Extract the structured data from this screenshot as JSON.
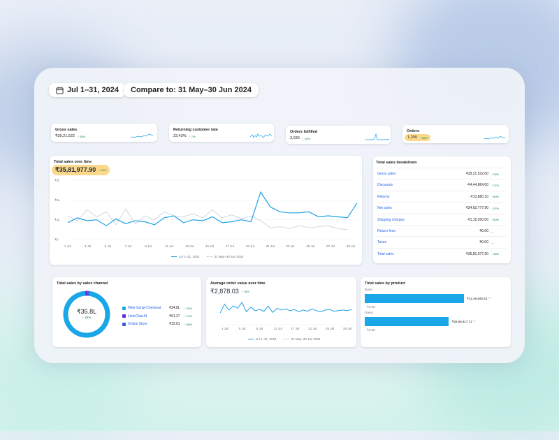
{
  "date_range": {
    "label": "Jul 1–31, 2024"
  },
  "compare": {
    "label": "Compare to: 31 May–30 Jun 2024"
  },
  "metrics": [
    {
      "title": "Gross sales",
      "value": "₹39,21,522",
      "change": "↑ 28%"
    },
    {
      "title": "Returning customer rate",
      "value": "23.43%",
      "change": "↑ 7%"
    },
    {
      "title": "Orders fulfilled",
      "value": "3,039",
      "change": "↑ 16%"
    },
    {
      "title": "Orders",
      "value": "1,209",
      "change": "↑ 65%"
    }
  ],
  "sales_over_time": {
    "title": "Total sales over time",
    "value": "₹35,81,977.90",
    "change": "↑ 36%",
    "legend_current": "Jul 1–31, 2024",
    "legend_previous": "31 May–30 Jun 2024"
  },
  "chart_data": [
    {
      "type": "line",
      "title": "Total sales over time",
      "y_ticks": [
        "₹3L",
        "₹2L",
        "₹1L",
        "₹0"
      ],
      "ylim": [
        0,
        300000
      ],
      "x_ticks": [
        "1 Jul",
        "3 Jul",
        "5 Jul",
        "7 Jul",
        "9 Jul",
        "11 Jul",
        "13 Jul",
        "15 Jul",
        "17 Jul",
        "19 Jul",
        "21 Jul",
        "23 Jul",
        "25 Jul",
        "27 Jul",
        "29 Jul"
      ],
      "series": [
        {
          "name": "Jul 1–31, 2024",
          "color": "#1da1e6",
          "values": [
            85000,
            110000,
            95000,
            100000,
            70000,
            105000,
            80000,
            95000,
            90000,
            75000,
            110000,
            120000,
            85000,
            100000,
            95000,
            115000,
            85000,
            90000,
            100000,
            90000,
            240000,
            165000,
            140000,
            135000,
            135000,
            140000,
            115000,
            120000,
            115000,
            110000,
            185000
          ]
        },
        {
          "name": "31 May–30 Jun 2024",
          "color": "#c7cdd6",
          "values": [
            120000,
            95000,
            150000,
            115000,
            140000,
            75000,
            155000,
            80000,
            120000,
            100000,
            140000,
            120000,
            115000,
            130000,
            110000,
            150000,
            110000,
            125000,
            105000,
            120000,
            95000,
            60000,
            65000,
            55000,
            70000,
            60000,
            65000,
            70000,
            55000,
            50000
          ]
        }
      ]
    },
    {
      "type": "pie",
      "title": "Total sales by sales channel",
      "center_value": "₹35.8L",
      "center_change": "↑ 36%",
      "slices": [
        {
          "label": "Web-Sangi-Checkout",
          "value": "₹34.8L",
          "change": "↑ 40%",
          "color": "#1aa7e8",
          "share": 0.97
        },
        {
          "label": "LimeChat AI",
          "value": "₹91.27",
          "change": "↑ 74%",
          "color": "#6d28d9",
          "share": 0.02
        },
        {
          "label": "Online Store",
          "value": "₹12.61",
          "change": "↑ 68%",
          "color": "#3b5bdb",
          "share": 0.01
        }
      ]
    },
    {
      "type": "line",
      "title": "Average order value over time",
      "value": "₹2,878.03",
      "change": "↑ 15%",
      "x_ticks": [
        "1 Jul",
        "5 Jul",
        "9 Jul",
        "13 Jul",
        "17 Jul",
        "21 Jul",
        "25 Jul",
        "29 Jul"
      ],
      "legend_current": "Jul 1–31, 2024",
      "legend_previous": "31 May–30 Jun 2024",
      "series": [
        {
          "name": "Jul 1–31, 2024",
          "color": "#1da1e6",
          "values": [
            40,
            55,
            45,
            52,
            48,
            58,
            42,
            50,
            44,
            46,
            43,
            52,
            41,
            48,
            45,
            47,
            44,
            46,
            42,
            45,
            43,
            47,
            44,
            42,
            45,
            46,
            43,
            44,
            45,
            44,
            46
          ]
        }
      ]
    },
    {
      "type": "bar",
      "title": "Total sales by product",
      "categories": [
        "None",
        "Dress"
      ],
      "values": [
        3146845,
        2669617
      ],
      "value_labels": [
        "₹31,46,845.63",
        "₹26,69,617.71"
      ],
      "color": "#1aa7e8"
    }
  ],
  "breakdown": {
    "title": "Total sales breakdown",
    "rows": [
      {
        "label": "Gross sales",
        "value": "₹39,21,522.00",
        "change": "↑ 26%"
      },
      {
        "label": "Discounts",
        "value": "-₹4,44,864.00",
        "change": "↑ 77%"
      },
      {
        "label": "Returns",
        "value": "-₹13,880.10",
        "change": "↑ 69%"
      },
      {
        "label": "Net sales",
        "value": "₹34,62,777.90",
        "change": "↑ 37%"
      },
      {
        "label": "Shipping charges",
        "value": "₹1,19,200.00",
        "change": "↑ 60%"
      },
      {
        "label": "Return fees",
        "value": "₹0.00",
        "change": "—"
      },
      {
        "label": "Taxes",
        "value": "₹0.00",
        "change": "—"
      },
      {
        "label": "Total sales",
        "value": "₹35,81,977.90",
        "change": "↑ 36%"
      }
    ]
  },
  "products": {
    "title": "Total sales by product",
    "items": [
      {
        "name": "None",
        "value": "₹31,46,845.63",
        "axis": "₹0.00"
      },
      {
        "name": "Dress",
        "value": "₹26,69,617.71",
        "axis": "₹0.00"
      }
    ]
  }
}
